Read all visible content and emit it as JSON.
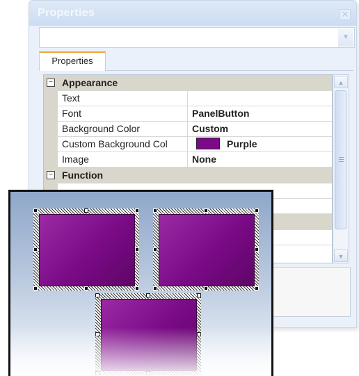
{
  "window": {
    "title": "Properties",
    "close_glyph": "✕",
    "close_icon": "close-icon",
    "combo_value": "",
    "combo_arrow_icon": "chevron-down-icon"
  },
  "tabs": [
    {
      "label": "Properties",
      "active": true
    }
  ],
  "property_grid": {
    "categories": [
      {
        "name": "Appearance",
        "expander": "⊟",
        "expanded": true,
        "properties": [
          {
            "name": "Text",
            "value": ""
          },
          {
            "name": "Font",
            "value": "PanelButton"
          },
          {
            "name": "Background Color",
            "value": "Custom"
          },
          {
            "name": "Custom Background Col",
            "value": "Purple",
            "swatch_color": "#7a0a86"
          },
          {
            "name": "Image",
            "value": "None"
          }
        ]
      },
      {
        "name": "Function",
        "expander": "⊟",
        "expanded": true,
        "properties": []
      }
    ]
  },
  "scrollbar": {
    "up_glyph": "▲",
    "down_glyph": "▼"
  },
  "designer": {
    "selected_button_count": 3,
    "button_color": "#7a0a86"
  }
}
